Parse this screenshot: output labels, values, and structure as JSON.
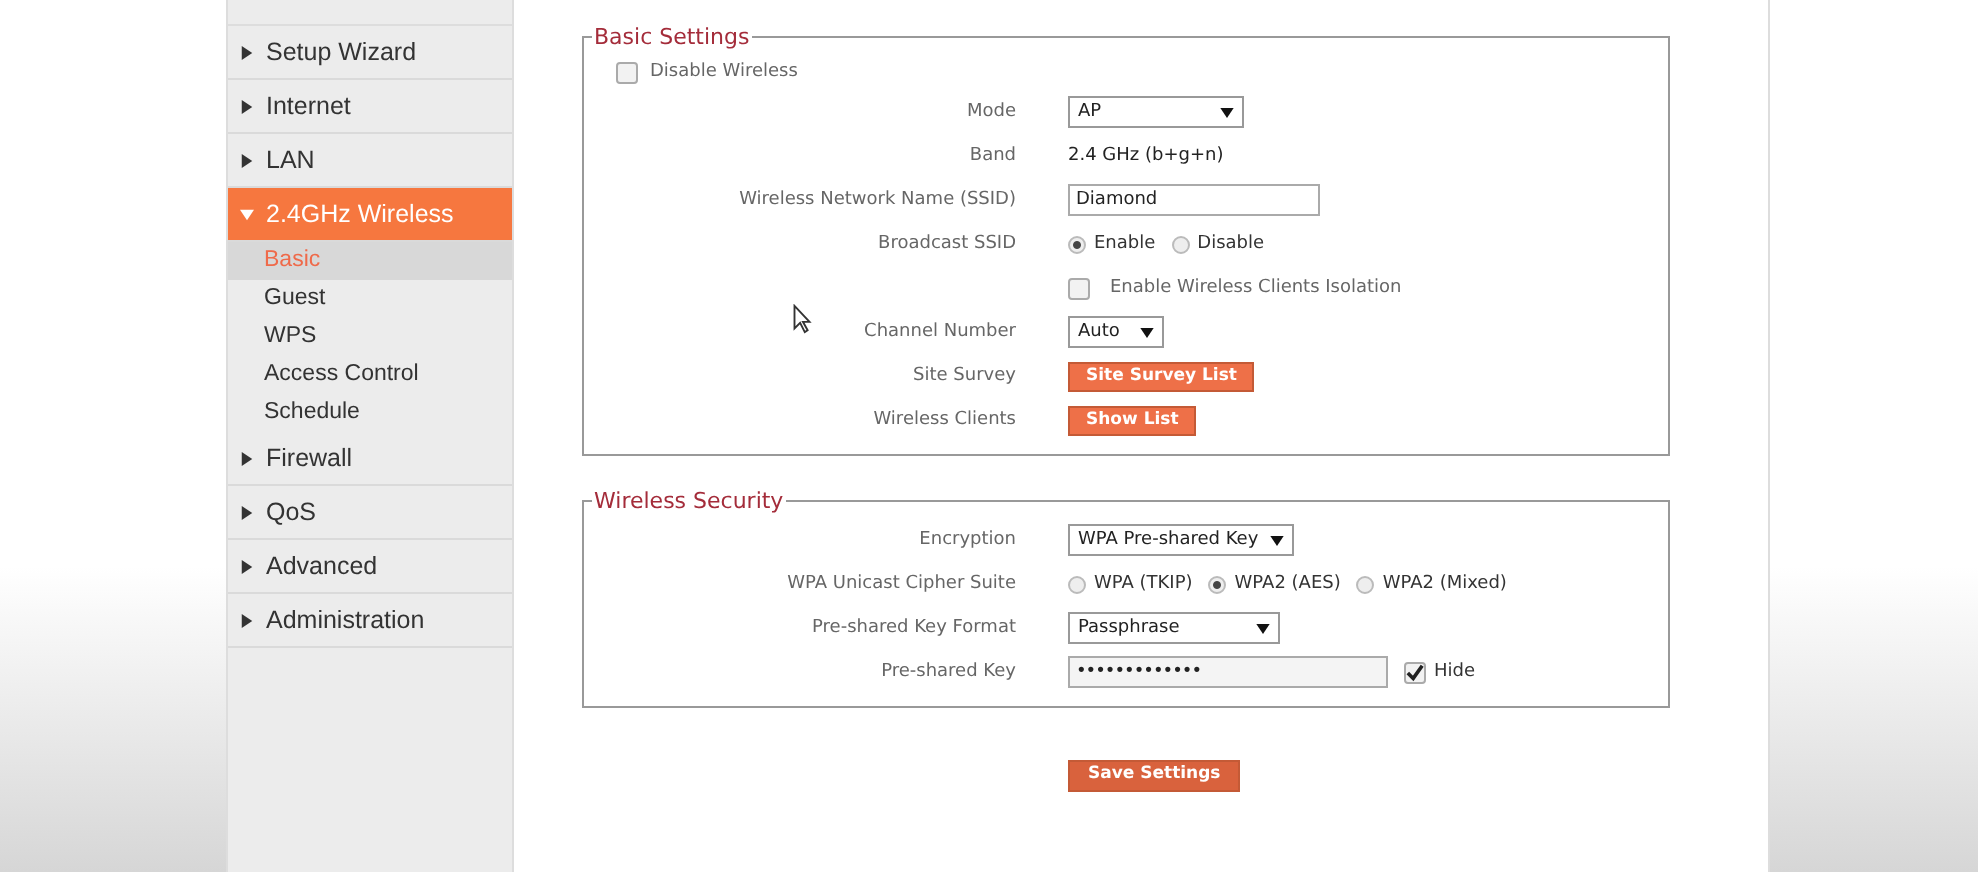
{
  "sidebar": {
    "items": [
      {
        "label": "Setup Wizard",
        "expanded": false,
        "selected": false
      },
      {
        "label": "Internet",
        "expanded": false,
        "selected": false
      },
      {
        "label": "LAN",
        "expanded": false,
        "selected": false
      },
      {
        "label": "2.4GHz Wireless",
        "expanded": true,
        "selected": true,
        "children": [
          {
            "label": "Basic",
            "selected": true
          },
          {
            "label": "Guest",
            "selected": false
          },
          {
            "label": "WPS",
            "selected": false
          },
          {
            "label": "Access Control",
            "selected": false
          },
          {
            "label": "Schedule",
            "selected": false
          }
        ]
      },
      {
        "label": "Firewall",
        "expanded": false,
        "selected": false
      },
      {
        "label": "QoS",
        "expanded": false,
        "selected": false
      },
      {
        "label": "Advanced",
        "expanded": false,
        "selected": false
      },
      {
        "label": "Administration",
        "expanded": false,
        "selected": false
      }
    ]
  },
  "sections": [
    {
      "title": "Basic Settings",
      "top_checkbox": {
        "label": "Disable  Wireless",
        "checked": false
      },
      "rows": [
        {
          "kind": "select",
          "label": "Mode",
          "value": "AP"
        },
        {
          "kind": "text",
          "label": "Band",
          "value": "2.4 GHz (b+g+n)"
        },
        {
          "kind": "input",
          "label": "Wireless Network Name  (SSID)",
          "value": "Diamond"
        },
        {
          "kind": "radio",
          "label": "Broadcast SSID",
          "options": [
            {
              "label": "Enable",
              "selected": true
            },
            {
              "label": "Disable",
              "selected": false
            }
          ]
        },
        {
          "kind": "checkbox",
          "value": "Enable Wireless Clients Isolation",
          "checked": false
        },
        {
          "kind": "select",
          "label": "Channel Number",
          "value": "Auto"
        },
        {
          "kind": "button",
          "label": "Site Survey",
          "value": "Site Survey List"
        },
        {
          "kind": "button",
          "label": "Wireless Clients",
          "value": "Show List"
        }
      ]
    },
    {
      "title": "Wireless  Security",
      "rows": [
        {
          "kind": "select",
          "label": "Encryption",
          "value": "WPA Pre-shared Key"
        },
        {
          "kind": "radio",
          "label": "WPA Unicast Cipher Suite",
          "options": [
            {
              "label": "WPA (TKIP)",
              "selected": false
            },
            {
              "label": "WPA2 (AES)",
              "selected": true
            },
            {
              "label": "WPA2 (Mixed)",
              "selected": false
            }
          ]
        },
        {
          "kind": "select",
          "label": "Pre-shared Key Format",
          "value": "Passphrase"
        },
        {
          "kind": "password",
          "label": "Pre-shared Key",
          "value": "•••••••••••••",
          "hide": {
            "label": "Hide",
            "checked": true
          }
        }
      ]
    }
  ],
  "save_button": "Save Settings"
}
